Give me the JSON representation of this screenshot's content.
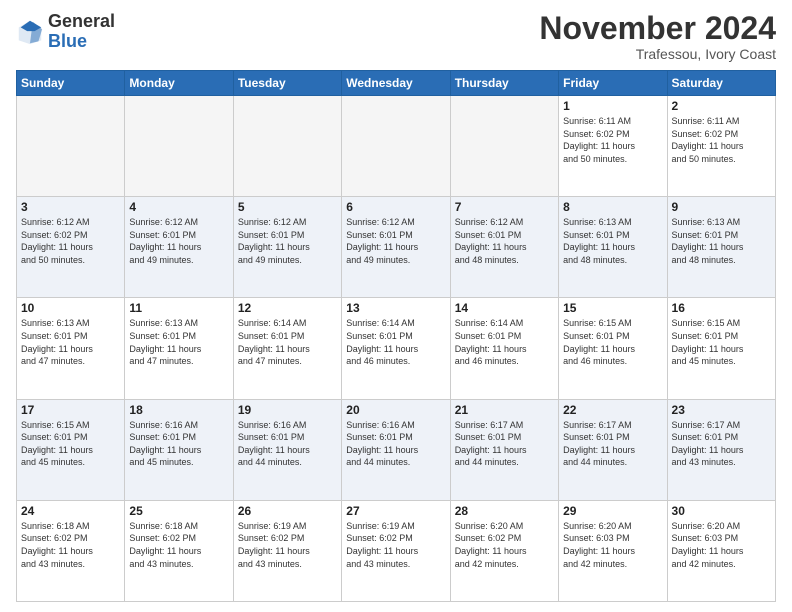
{
  "header": {
    "logo_general": "General",
    "logo_blue": "Blue",
    "month_title": "November 2024",
    "location": "Trafessou, Ivory Coast"
  },
  "days_of_week": [
    "Sunday",
    "Monday",
    "Tuesday",
    "Wednesday",
    "Thursday",
    "Friday",
    "Saturday"
  ],
  "weeks": [
    [
      {
        "day": "",
        "info": ""
      },
      {
        "day": "",
        "info": ""
      },
      {
        "day": "",
        "info": ""
      },
      {
        "day": "",
        "info": ""
      },
      {
        "day": "",
        "info": ""
      },
      {
        "day": "1",
        "info": "Sunrise: 6:11 AM\nSunset: 6:02 PM\nDaylight: 11 hours\nand 50 minutes."
      },
      {
        "day": "2",
        "info": "Sunrise: 6:11 AM\nSunset: 6:02 PM\nDaylight: 11 hours\nand 50 minutes."
      }
    ],
    [
      {
        "day": "3",
        "info": "Sunrise: 6:12 AM\nSunset: 6:02 PM\nDaylight: 11 hours\nand 50 minutes."
      },
      {
        "day": "4",
        "info": "Sunrise: 6:12 AM\nSunset: 6:01 PM\nDaylight: 11 hours\nand 49 minutes."
      },
      {
        "day": "5",
        "info": "Sunrise: 6:12 AM\nSunset: 6:01 PM\nDaylight: 11 hours\nand 49 minutes."
      },
      {
        "day": "6",
        "info": "Sunrise: 6:12 AM\nSunset: 6:01 PM\nDaylight: 11 hours\nand 49 minutes."
      },
      {
        "day": "7",
        "info": "Sunrise: 6:12 AM\nSunset: 6:01 PM\nDaylight: 11 hours\nand 48 minutes."
      },
      {
        "day": "8",
        "info": "Sunrise: 6:13 AM\nSunset: 6:01 PM\nDaylight: 11 hours\nand 48 minutes."
      },
      {
        "day": "9",
        "info": "Sunrise: 6:13 AM\nSunset: 6:01 PM\nDaylight: 11 hours\nand 48 minutes."
      }
    ],
    [
      {
        "day": "10",
        "info": "Sunrise: 6:13 AM\nSunset: 6:01 PM\nDaylight: 11 hours\nand 47 minutes."
      },
      {
        "day": "11",
        "info": "Sunrise: 6:13 AM\nSunset: 6:01 PM\nDaylight: 11 hours\nand 47 minutes."
      },
      {
        "day": "12",
        "info": "Sunrise: 6:14 AM\nSunset: 6:01 PM\nDaylight: 11 hours\nand 47 minutes."
      },
      {
        "day": "13",
        "info": "Sunrise: 6:14 AM\nSunset: 6:01 PM\nDaylight: 11 hours\nand 46 minutes."
      },
      {
        "day": "14",
        "info": "Sunrise: 6:14 AM\nSunset: 6:01 PM\nDaylight: 11 hours\nand 46 minutes."
      },
      {
        "day": "15",
        "info": "Sunrise: 6:15 AM\nSunset: 6:01 PM\nDaylight: 11 hours\nand 46 minutes."
      },
      {
        "day": "16",
        "info": "Sunrise: 6:15 AM\nSunset: 6:01 PM\nDaylight: 11 hours\nand 45 minutes."
      }
    ],
    [
      {
        "day": "17",
        "info": "Sunrise: 6:15 AM\nSunset: 6:01 PM\nDaylight: 11 hours\nand 45 minutes."
      },
      {
        "day": "18",
        "info": "Sunrise: 6:16 AM\nSunset: 6:01 PM\nDaylight: 11 hours\nand 45 minutes."
      },
      {
        "day": "19",
        "info": "Sunrise: 6:16 AM\nSunset: 6:01 PM\nDaylight: 11 hours\nand 44 minutes."
      },
      {
        "day": "20",
        "info": "Sunrise: 6:16 AM\nSunset: 6:01 PM\nDaylight: 11 hours\nand 44 minutes."
      },
      {
        "day": "21",
        "info": "Sunrise: 6:17 AM\nSunset: 6:01 PM\nDaylight: 11 hours\nand 44 minutes."
      },
      {
        "day": "22",
        "info": "Sunrise: 6:17 AM\nSunset: 6:01 PM\nDaylight: 11 hours\nand 44 minutes."
      },
      {
        "day": "23",
        "info": "Sunrise: 6:17 AM\nSunset: 6:01 PM\nDaylight: 11 hours\nand 43 minutes."
      }
    ],
    [
      {
        "day": "24",
        "info": "Sunrise: 6:18 AM\nSunset: 6:02 PM\nDaylight: 11 hours\nand 43 minutes."
      },
      {
        "day": "25",
        "info": "Sunrise: 6:18 AM\nSunset: 6:02 PM\nDaylight: 11 hours\nand 43 minutes."
      },
      {
        "day": "26",
        "info": "Sunrise: 6:19 AM\nSunset: 6:02 PM\nDaylight: 11 hours\nand 43 minutes."
      },
      {
        "day": "27",
        "info": "Sunrise: 6:19 AM\nSunset: 6:02 PM\nDaylight: 11 hours\nand 43 minutes."
      },
      {
        "day": "28",
        "info": "Sunrise: 6:20 AM\nSunset: 6:02 PM\nDaylight: 11 hours\nand 42 minutes."
      },
      {
        "day": "29",
        "info": "Sunrise: 6:20 AM\nSunset: 6:03 PM\nDaylight: 11 hours\nand 42 minutes."
      },
      {
        "day": "30",
        "info": "Sunrise: 6:20 AM\nSunset: 6:03 PM\nDaylight: 11 hours\nand 42 minutes."
      }
    ]
  ]
}
